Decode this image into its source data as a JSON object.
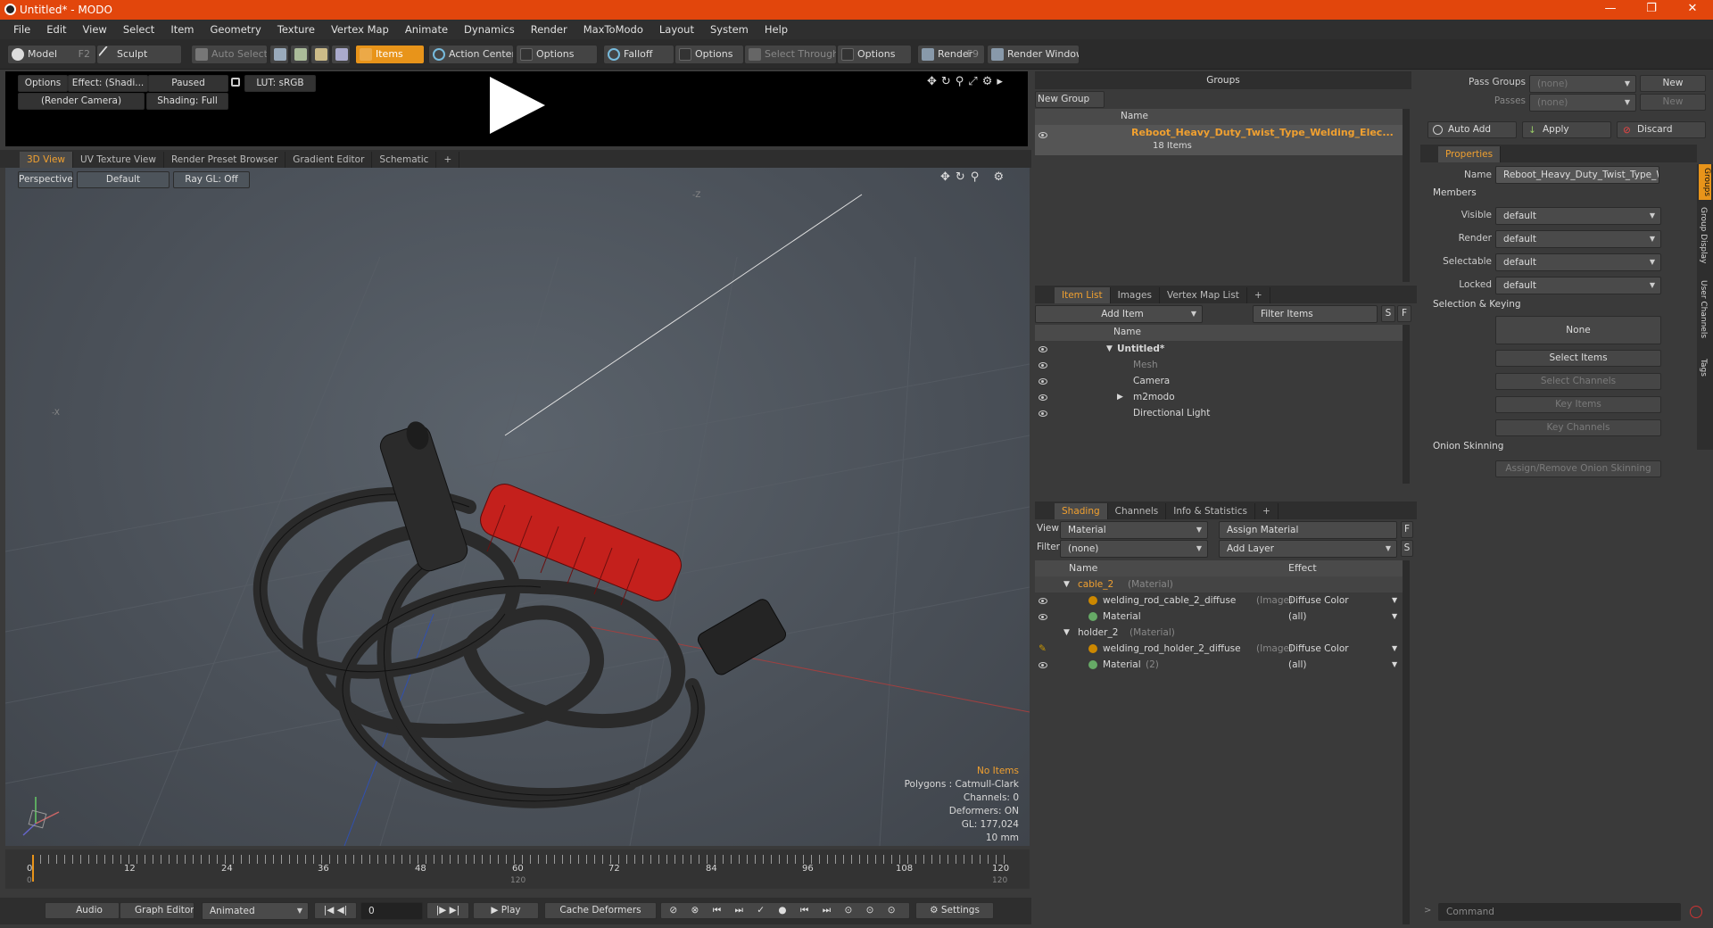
{
  "window": {
    "title": "Untitled* - MODO",
    "min": "—",
    "max": "❐",
    "close": "✕"
  },
  "menu": [
    "File",
    "Edit",
    "View",
    "Select",
    "Item",
    "Geometry",
    "Texture",
    "Vertex Map",
    "Animate",
    "Dynamics",
    "Render",
    "MaxToModo",
    "Layout",
    "System",
    "Help"
  ],
  "toolbar": {
    "model": "Model",
    "model_key": "F2",
    "sculpt": "Sculpt",
    "auto_select": "Auto Select",
    "items": "Items",
    "action_center": "Action Center",
    "options1": "Options",
    "falloff": "Falloff",
    "options2": "Options",
    "select_through": "Select Through",
    "options3": "Options",
    "render": "Render",
    "render_key": "F9",
    "render_window": "Render Window"
  },
  "preview": {
    "options": "Options",
    "effect": "Effect: (Shadi...",
    "paused": "Paused",
    "lut": "LUT: sRGB",
    "camera": "(Render Camera)",
    "shading": "Shading: Full"
  },
  "viewport": {
    "tabs": [
      "3D View",
      "UV Texture View",
      "Render Preset Browser",
      "Gradient Editor",
      "Schematic",
      "+"
    ],
    "perspective": "Perspective",
    "default": "Default",
    "raygl": "Ray GL: Off",
    "info": {
      "no_items": "No Items",
      "polygons": "Polygons : Catmull-Clark",
      "channels": "Channels: 0",
      "deformers": "Deformers: ON",
      "gl": "GL: 177,024",
      "scale": "10 mm"
    },
    "axis_neg_z": "-Z",
    "axis_neg_x": "-X"
  },
  "timeline": {
    "ticks": [
      "0",
      "12",
      "24",
      "36",
      "48",
      "60",
      "72",
      "84",
      "96",
      "108",
      "120"
    ],
    "sub_ticks": [
      "0",
      "120",
      "120"
    ]
  },
  "bottombar": {
    "audio": "Audio",
    "graph_editor": "Graph Editor",
    "animated": "Animated",
    "frame": "0",
    "play": "Play",
    "cache": "Cache Deformers",
    "settings": "Settings",
    "command": "Command"
  },
  "groups": {
    "header": "Groups",
    "new_group": "New Group",
    "col_name": "Name",
    "item_name": "Reboot_Heavy_Duty_Twist_Type_Welding_Elec...",
    "item_count": "18 Items"
  },
  "itemlist": {
    "tabs": [
      "Item List",
      "Images",
      "Vertex Map List",
      "+"
    ],
    "add_item": "Add Item",
    "filter": "Filter Items",
    "s": "S",
    "f": "F",
    "col_name": "Name",
    "items": [
      {
        "name": "Untitled*",
        "sub": ""
      },
      {
        "name": "Mesh"
      },
      {
        "name": "Camera"
      },
      {
        "name": "m2modo"
      },
      {
        "name": "Directional Light"
      }
    ]
  },
  "shading": {
    "tabs": [
      "Shading",
      "Channels",
      "Info & Statistics",
      "+"
    ],
    "view_label": "View",
    "view_val": "Material",
    "assign": "Assign Material",
    "f": "F",
    "filter_label": "Filter",
    "filter_val": "(none)",
    "add_layer": "Add Layer",
    "s": "S",
    "col_name": "Name",
    "col_effect": "Effect",
    "rows": [
      {
        "name": "cable_2",
        "tag": "(Material)",
        "effect": ""
      },
      {
        "name": "welding_rod_cable_2_diffuse",
        "tag": "(Image)",
        "effect": "Diffuse Color"
      },
      {
        "name": "Material",
        "tag": "",
        "effect": "(all)"
      },
      {
        "name": "holder_2",
        "tag": "(Material)",
        "effect": ""
      },
      {
        "name": "welding_rod_holder_2_diffuse",
        "tag": "(Image)",
        "effect": "Diffuse Color"
      },
      {
        "name": "Material",
        "tag": "(2)",
        "effect": "(all)"
      }
    ]
  },
  "properties": {
    "pass_groups": "Pass Groups",
    "passes": "Passes",
    "none": "(none)",
    "new": "New",
    "auto_add": "Auto Add",
    "apply": "Apply",
    "discard": "Discard",
    "tab": "Properties",
    "name_label": "Name",
    "name_val": "Reboot_Heavy_Duty_Twist_Type_W",
    "members": "Members",
    "visible": "Visible",
    "render": "Render",
    "selectable": "Selectable",
    "locked": "Locked",
    "default": "default",
    "sel_keying": "Selection & Keying",
    "none_btn": "None",
    "select_items": "Select Items",
    "select_channels": "Select Channels",
    "key_items": "Key Items",
    "key_channels": "Key Channels",
    "onion": "Onion Skinning",
    "assign_onion": "Assign/Remove Onion Skinning",
    "side_tabs": [
      "Groups",
      "Group Display",
      "User Channels",
      "Tags"
    ]
  }
}
